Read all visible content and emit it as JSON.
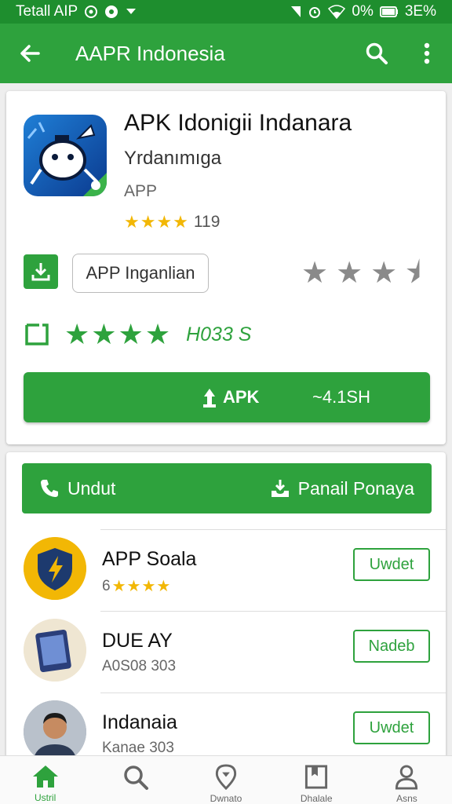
{
  "status_bar": {
    "left_text": "Tetall AIP",
    "battery_text": "0%",
    "right_text": "3E%"
  },
  "app_bar": {
    "title": "AAPR Indonesia"
  },
  "app": {
    "title": "APK Idonigii Indanara",
    "subtitle": "Yrdanımıga",
    "type": "APP",
    "rating_stars": "★★★★",
    "rating_count": "119",
    "chip_label": "APP Inganlian",
    "green_stars": "★★★★",
    "green_count": "H033 S",
    "download_label": "APK",
    "download_size": "~4.1SH"
  },
  "section": {
    "left_label": "Undut",
    "right_label": "Panail Ponaya"
  },
  "list": [
    {
      "title": "APP Soala",
      "sub_prefix": "6",
      "sub_stars": "★★★★",
      "sub_text": "",
      "button": "Uwdet",
      "icon": "shield-bolt-icon"
    },
    {
      "title": "DUE AY",
      "sub_prefix": "",
      "sub_stars": "",
      "sub_text": "A0S08 303",
      "button": "Nadeb",
      "icon": "tablet-icon"
    },
    {
      "title": "Indanaia",
      "sub_prefix": "",
      "sub_stars": "",
      "sub_text": "Kanae 303",
      "button": "Uwdet",
      "icon": "person-avatar-icon"
    }
  ],
  "bottom_nav": [
    {
      "label": "Ustril",
      "icon": "home-icon"
    },
    {
      "label": "",
      "icon": "search-icon"
    },
    {
      "label": "Dwnato",
      "icon": "location-icon"
    },
    {
      "label": "Dhalale",
      "icon": "book-icon"
    },
    {
      "label": "Asns",
      "icon": "profile-icon"
    }
  ],
  "colors": {
    "primary": "#2ea23d",
    "status_bar": "#1e8e2e",
    "gold": "#f2b705"
  }
}
